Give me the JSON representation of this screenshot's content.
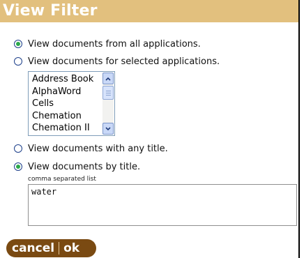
{
  "header": {
    "title": "View Filter"
  },
  "options": {
    "all_apps": "View documents from all applications.",
    "selected_apps": "View documents for selected applications.",
    "any_title": "View documents with any title.",
    "by_title": "View documents by title."
  },
  "applications_list": {
    "items": [
      "Address Book",
      "AlphaWord",
      "Cells",
      "Chemation",
      "Chemation II"
    ]
  },
  "title_filter": {
    "label": "comma separated list",
    "value": "water"
  },
  "buttons": {
    "cancel": "cancel",
    "ok": "ok"
  },
  "colors": {
    "header_bg": "#e2c07e",
    "radio_selected": "#2aa84a",
    "button_bg": "#7a4a12"
  }
}
